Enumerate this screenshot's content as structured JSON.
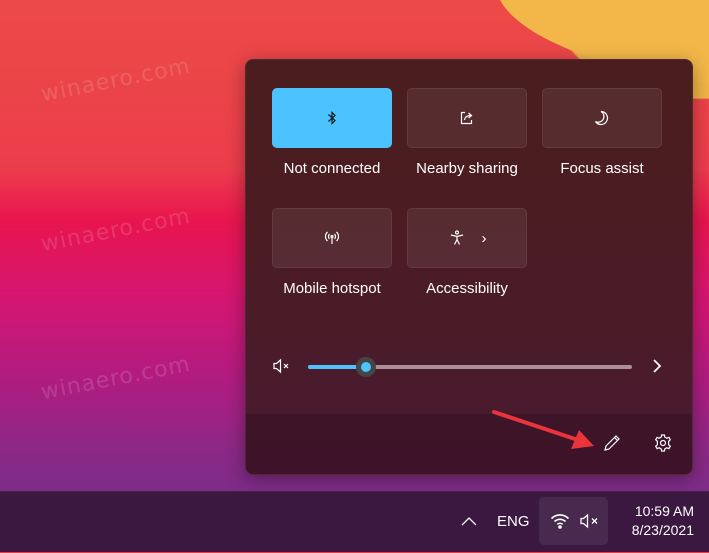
{
  "watermark": "winaero.com",
  "quick_settings": {
    "tiles": [
      {
        "label": "Not connected",
        "icon": "bluetooth-icon",
        "active": true
      },
      {
        "label": "Nearby sharing",
        "icon": "share-icon",
        "active": false
      },
      {
        "label": "Focus assist",
        "icon": "moon-icon",
        "active": false
      },
      {
        "label": "Mobile hotspot",
        "icon": "hotspot-icon",
        "active": false
      },
      {
        "label": "Accessibility",
        "icon": "accessibility-icon",
        "active": false,
        "has_submenu": true,
        "chevron": "›"
      }
    ],
    "volume": {
      "muted": true,
      "level_percent": 18,
      "more_icon": "chevron-right-icon"
    },
    "footer": {
      "edit_icon": "pencil-icon",
      "settings_icon": "gear-icon"
    }
  },
  "annotation": {
    "type": "red-arrow",
    "color": "#e8343a",
    "points_to": "edit-quick-settings-button"
  },
  "colors": {
    "accent": "#4cc2ff"
  },
  "taskbar": {
    "tray_chevron": "^",
    "language": "ENG",
    "network_icon": "wifi-icon",
    "volume_icon": "volume-muted-icon",
    "time": "10:59 AM",
    "date": "8/23/2021"
  }
}
